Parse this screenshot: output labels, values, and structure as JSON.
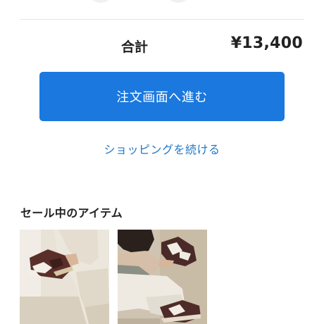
{
  "cart": {
    "total_label": "合計",
    "total_value": "¥13,400"
  },
  "checkout": {
    "button_label": "注文画面へ進む"
  },
  "continue_shopping": {
    "label": "ショッピングを続ける"
  },
  "sale_section": {
    "title": "セール中のアイテム",
    "items": [
      {
        "image": "product-photo-brown-sneakers-white-pants-1"
      },
      {
        "image": "product-photo-brown-sneakers-white-pants-2"
      }
    ]
  },
  "colors": {
    "accent": "#1a78de",
    "link": "#1f78c6",
    "divider": "#e6e6e6"
  }
}
